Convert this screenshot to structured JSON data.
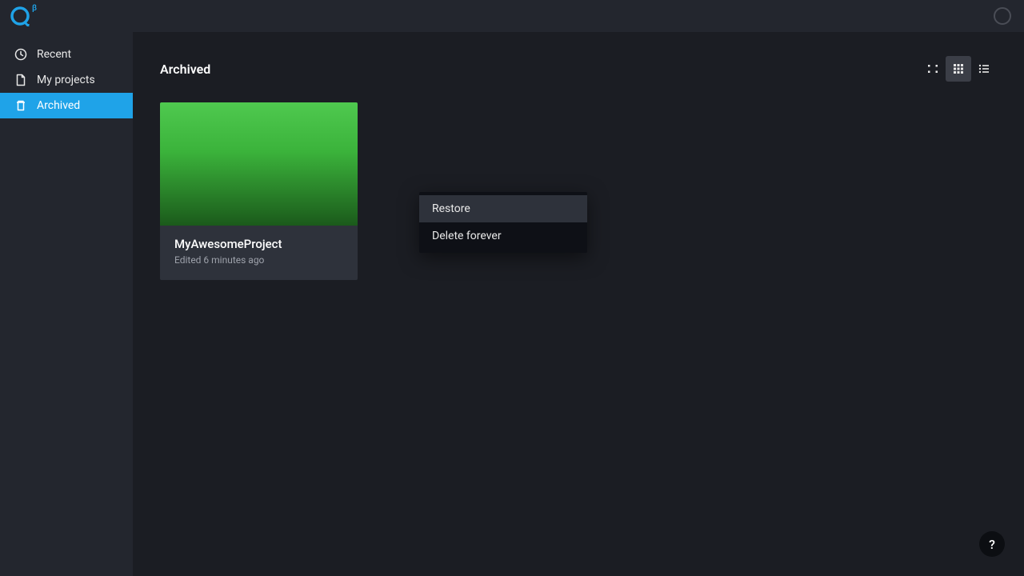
{
  "topbar": {
    "beta_label": "β"
  },
  "sidebar": {
    "items": [
      {
        "label": "Recent",
        "icon": "clock-icon",
        "active": false
      },
      {
        "label": "My projects",
        "icon": "file-icon",
        "active": false
      },
      {
        "label": "Archived",
        "icon": "trash-icon",
        "active": true
      }
    ]
  },
  "main": {
    "title": "Archived",
    "view_modes": [
      {
        "name": "compact-grid",
        "active": false
      },
      {
        "name": "grid",
        "active": true
      },
      {
        "name": "list",
        "active": false
      }
    ],
    "projects": [
      {
        "name": "MyAwesomeProject",
        "edited": "Edited 6 minutes ago"
      }
    ]
  },
  "context_menu": {
    "items": [
      {
        "label": "Restore",
        "hovered": true
      },
      {
        "label": "Delete forever",
        "hovered": false
      }
    ]
  },
  "help": {
    "label": "?"
  }
}
